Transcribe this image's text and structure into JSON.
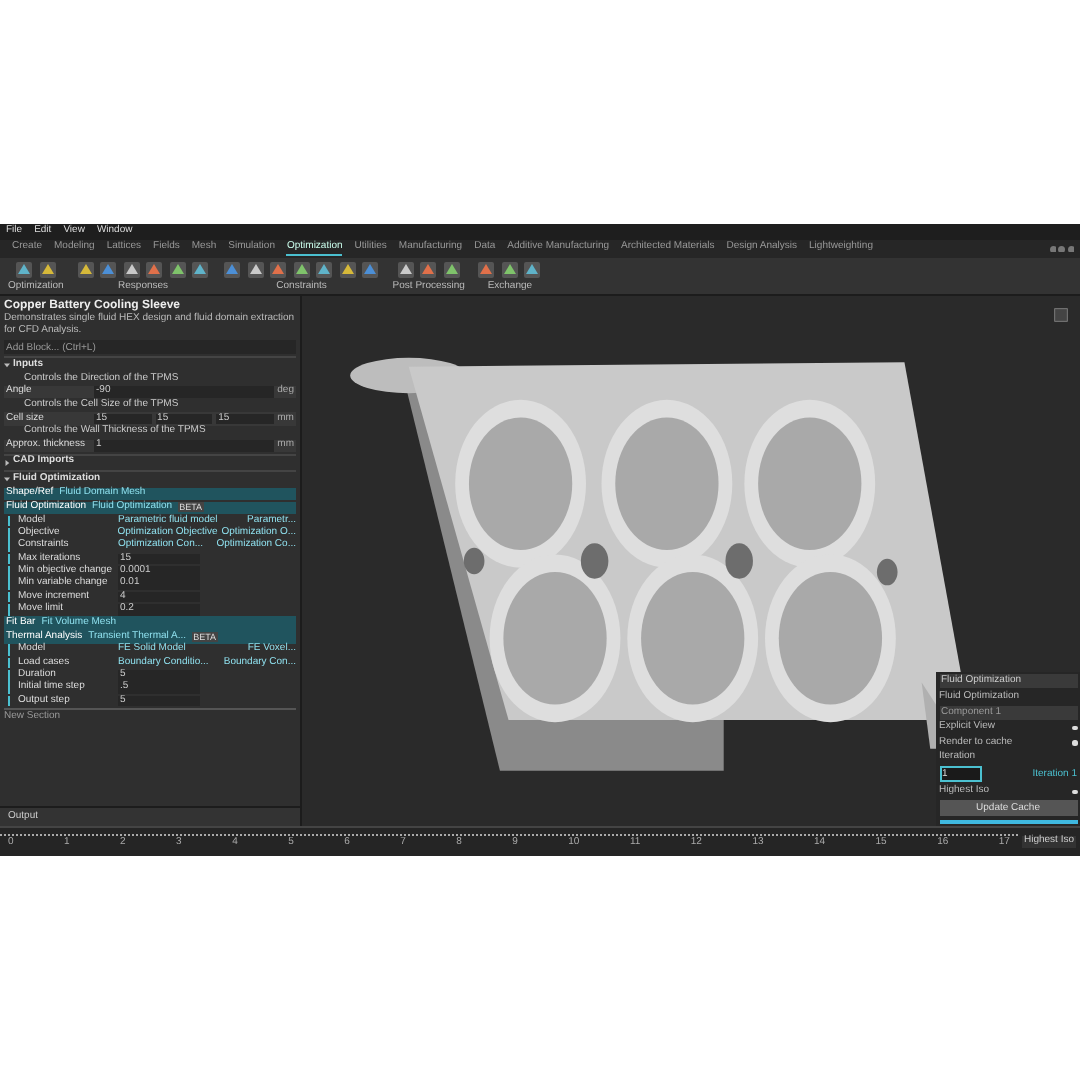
{
  "menu": [
    "File",
    "Edit",
    "View",
    "Window"
  ],
  "tabs": [
    {
      "label": "Create",
      "selected": false
    },
    {
      "label": "Modeling",
      "selected": false
    },
    {
      "label": "Lattices",
      "selected": false
    },
    {
      "label": "Fields",
      "selected": false
    },
    {
      "label": "Mesh",
      "selected": false
    },
    {
      "label": "Simulation",
      "selected": false
    },
    {
      "label": "Optimization",
      "selected": true
    },
    {
      "label": "Utilities",
      "selected": false
    },
    {
      "label": "Manufacturing",
      "selected": false
    },
    {
      "label": "Data",
      "selected": false
    },
    {
      "label": "Additive Manufacturing",
      "selected": false
    },
    {
      "label": "Architected Materials",
      "selected": false
    },
    {
      "label": "Design Analysis",
      "selected": false
    },
    {
      "label": "Lightweighting",
      "selected": false
    }
  ],
  "toolbar_groups": [
    "Optimization",
    "Responses",
    "Constraints",
    "Post Processing",
    "Exchange"
  ],
  "panel": {
    "title": "Copper Battery Cooling Sleeve",
    "description": "Demonstrates single fluid HEX design and fluid domain extraction for CFD Analysis.",
    "add_block": {
      "placeholder": "Add Block... (Ctrl+L)"
    },
    "sections": [
      {
        "title": "Inputs",
        "expanded": true,
        "rows": [
          {
            "kind": "comment",
            "text": "Controls the Direction of the TPMS"
          },
          {
            "kind": "input",
            "label": "Angle",
            "values": [
              "-90"
            ],
            "unit": "deg"
          },
          {
            "kind": "comment",
            "text": "Controls the Cell Size of the TPMS"
          },
          {
            "kind": "input",
            "label": "Cell size",
            "values": [
              "15",
              "15",
              "15"
            ],
            "unit": "mm"
          },
          {
            "kind": "comment",
            "text": "Controls the Wall Thickness of the TPMS"
          },
          {
            "kind": "input",
            "label": "Approx. thickness",
            "values": [
              "1"
            ],
            "unit": "mm"
          }
        ]
      },
      {
        "title": "CAD Imports",
        "expanded": false
      },
      {
        "title": "Fluid Optimization",
        "expanded": true,
        "rows": [
          {
            "kind": "block",
            "label": "Shape/Ref",
            "type": "Fluid Domain Mesh",
            "badge": "",
            "children": []
          },
          {
            "kind": "block",
            "label": "Fluid Optimization",
            "type": "Fluid Optimization",
            "badge": "BETA",
            "children": [
              {
                "kind": "param",
                "label": "Model",
                "value": "Parametric fluid model",
                "type": "Parametr..."
              },
              {
                "kind": "param",
                "label": "Objective",
                "value": "Optimization Objective",
                "type": "Optimization O..."
              },
              {
                "kind": "param",
                "label": "Constraints",
                "value": "Optimization Con...",
                "type": "Optimization Co..."
              },
              {
                "kind": "value",
                "label": "Max iterations",
                "value": "15"
              },
              {
                "kind": "value",
                "label": "Min objective change",
                "value": "0.0001"
              },
              {
                "kind": "value",
                "label": "Min variable change",
                "value": "0.01"
              },
              {
                "kind": "value",
                "label": "Move increment",
                "value": "4"
              },
              {
                "kind": "value",
                "label": "Move limit",
                "value": "0.2"
              }
            ]
          },
          {
            "kind": "block",
            "label": "Fit Bar",
            "type": "Fit Volume Mesh",
            "badge": "",
            "children": []
          },
          {
            "kind": "block",
            "label": "Thermal Analysis",
            "type": "Transient Thermal A...",
            "badge": "BETA",
            "children": [
              {
                "kind": "param",
                "label": "Model",
                "value": "FE Solid Model",
                "type": "FE Voxel..."
              },
              {
                "kind": "param",
                "label": "Load cases",
                "value": "Boundary Conditio...",
                "type": "Boundary Con..."
              },
              {
                "kind": "value",
                "label": "Duration",
                "value": "5"
              },
              {
                "kind": "value",
                "label": "Initial time step",
                "value": ".5"
              },
              {
                "kind": "value",
                "label": "Output step",
                "value": "5"
              }
            ]
          }
        ]
      }
    ],
    "new_section": "New Section",
    "output": "Output"
  },
  "view_panel": {
    "dropdown": "Fluid Optimization",
    "label": "Fluid Optimization",
    "component": "Component 1",
    "toggles": [
      {
        "label": "Explicit View",
        "on": true
      },
      {
        "label": "Render to cache",
        "on": true
      }
    ],
    "iteration_label": "Iteration",
    "iteration_value": "1",
    "iteration_hint": "Iteration 1",
    "iso": {
      "label": "Highest Iso",
      "on": true
    },
    "button": "Update Cache",
    "progress": {
      "level": 1
    }
  },
  "timeline": {
    "labels": [
      "0",
      "1",
      "2",
      "3",
      "4",
      "5",
      "6",
      "7",
      "8",
      "9",
      "10",
      "11",
      "12",
      "13",
      "14",
      "15",
      "16",
      "17"
    ],
    "status": "Highest Iso"
  }
}
